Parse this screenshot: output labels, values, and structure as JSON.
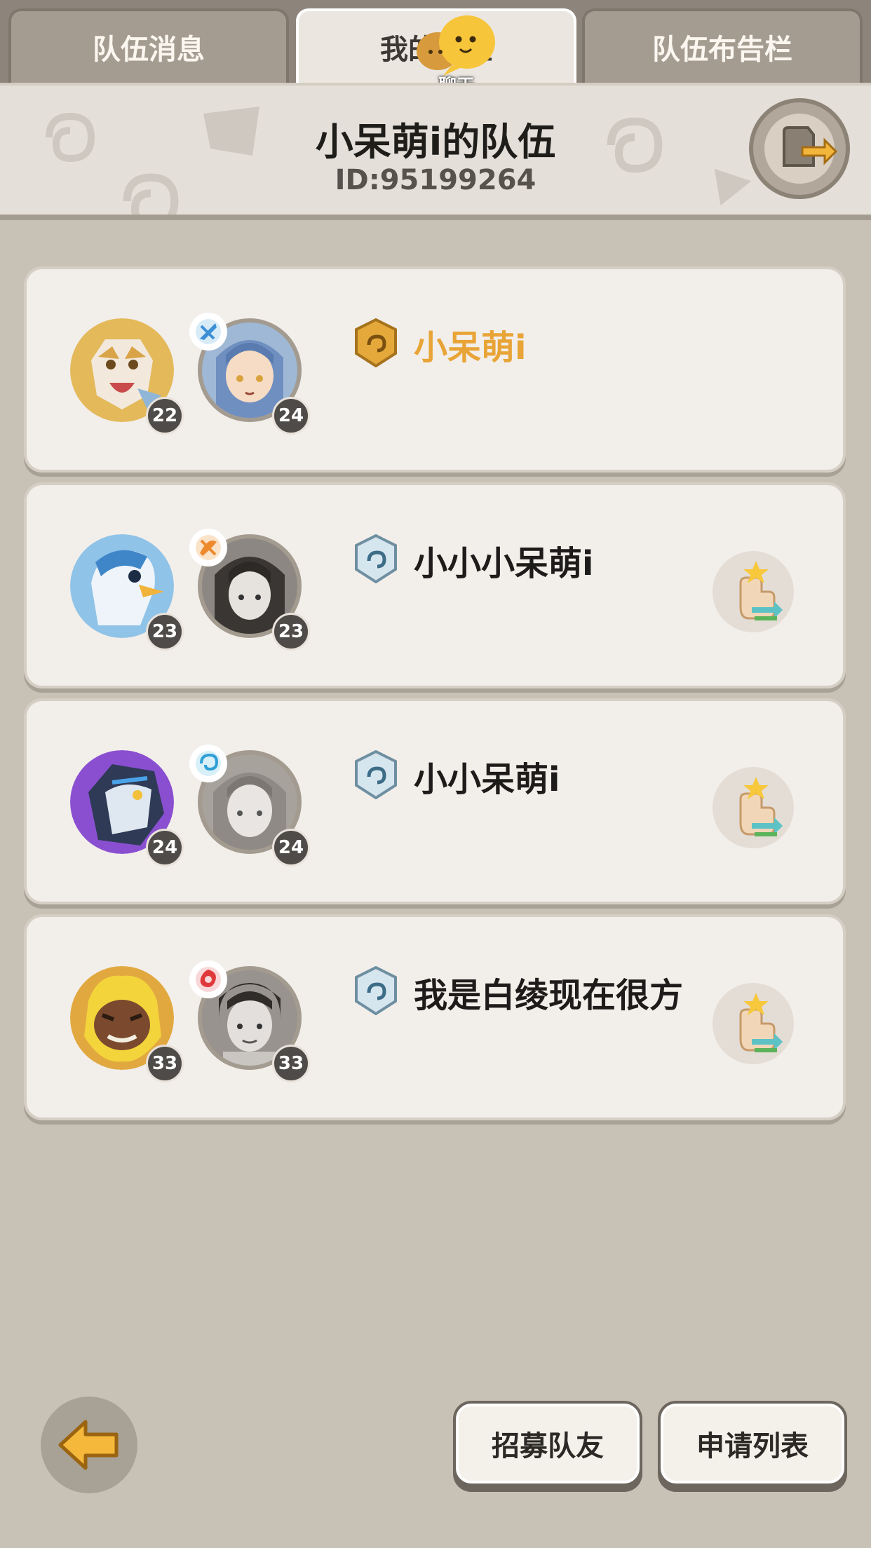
{
  "tabs": {
    "left": "队伍消息",
    "center": "我的队伍",
    "right": "队伍布告栏",
    "chat_label": "聊天"
  },
  "header": {
    "title": "小呆萌i的队伍",
    "id": "ID:95199264"
  },
  "members": [
    {
      "name": "小呆萌i",
      "pet_level": "22",
      "char_level": "24",
      "role": "leader"
    },
    {
      "name": "小小小呆萌i",
      "pet_level": "23",
      "char_level": "23",
      "role": "member"
    },
    {
      "name": "小小呆萌i",
      "pet_level": "24",
      "char_level": "24",
      "role": "member"
    },
    {
      "name": "我是白绫现在很方",
      "pet_level": "33",
      "char_level": "33",
      "role": "member"
    }
  ],
  "footer": {
    "recruit_label": "招募队友",
    "apply_label": "申请列表"
  },
  "colors": {
    "leader_name": "#e8a436",
    "background": "#c8c1b6",
    "card": "#f2eeea"
  },
  "icons": {
    "back": "back-arrow-icon",
    "exit": "exit-team-icon",
    "transfer": "transfer-leader-icon",
    "chat": "chat-bubble-icon"
  }
}
